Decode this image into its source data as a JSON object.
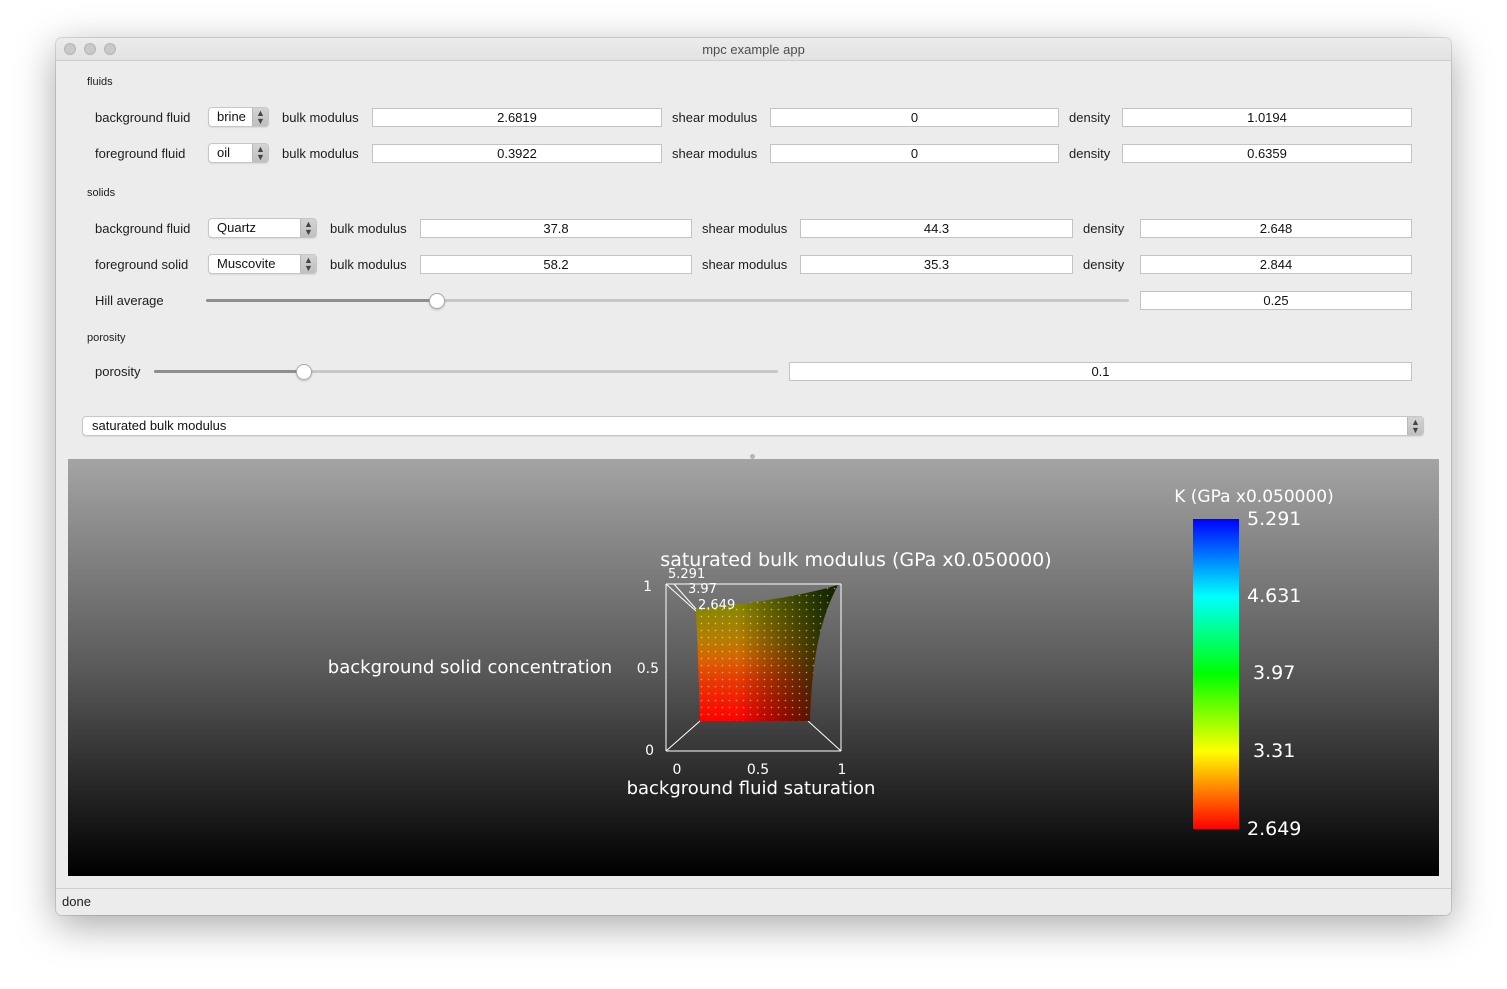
{
  "window": {
    "title": "mpc example app"
  },
  "fluids": {
    "section_label": "fluids",
    "rows": [
      {
        "label": "background fluid",
        "selected": "brine",
        "bulk_label": "bulk modulus",
        "bulk": "2.6819",
        "shear_label": "shear modulus",
        "shear": "0",
        "density_label": "density",
        "density": "1.0194"
      },
      {
        "label": "foreground fluid",
        "selected": "oil",
        "bulk_label": "bulk modulus",
        "bulk": "0.3922",
        "shear_label": "shear modulus",
        "shear": "0",
        "density_label": "density",
        "density": "0.6359"
      }
    ]
  },
  "solids": {
    "section_label": "solids",
    "rows": [
      {
        "label": "background fluid",
        "selected": "Quartz",
        "bulk_label": "bulk modulus",
        "bulk": "37.8",
        "shear_label": "shear modulus",
        "shear": "44.3",
        "density_label": "density",
        "density": "2.648"
      },
      {
        "label": "foreground solid",
        "selected": "Muscovite",
        "bulk_label": "bulk modulus",
        "bulk": "58.2",
        "shear_label": "shear modulus",
        "shear": "35.3",
        "density_label": "density",
        "density": "2.844"
      }
    ],
    "hill": {
      "label": "Hill average",
      "value": "0.25",
      "fraction": 0.25
    }
  },
  "porosity": {
    "section_label": "porosity",
    "label": "porosity",
    "value": "0.1",
    "fraction": 0.24
  },
  "property_select": {
    "selected": "saturated bulk modulus"
  },
  "plot": {
    "title": "saturated bulk modulus (GPa x0.050000)",
    "xlabel": "background fluid saturation",
    "ylabel": "background solid concentration",
    "x_ticks": [
      "0",
      "0.5",
      "1"
    ],
    "y_ticks": [
      "0",
      "0.5",
      "1"
    ],
    "contour_labels": [
      "5.291",
      "3.97",
      "2.649"
    ],
    "colorbar": {
      "title": "K (GPa x0.050000)",
      "ticks": [
        "5.291",
        "4.631",
        "3.97",
        "3.31",
        "2.649"
      ]
    }
  },
  "status": {
    "text": "done"
  },
  "chart_data": {
    "type": "heatmap",
    "title": "saturated bulk modulus (GPa x0.050000)",
    "xlabel": "background fluid saturation",
    "ylabel": "background solid concentration",
    "xlim": [
      0,
      1
    ],
    "ylim": [
      0,
      1
    ],
    "x_ticks": [
      0,
      0.5,
      1
    ],
    "y_ticks": [
      0,
      0.5,
      1
    ],
    "color_range": [
      2.649,
      5.291
    ],
    "colorbar_ticks": [
      5.291,
      4.631,
      3.97,
      3.31,
      2.649
    ],
    "colormap": [
      "#ff0000",
      "#ffff00",
      "#00ff00",
      "#00ffff",
      "#0000ff"
    ]
  }
}
